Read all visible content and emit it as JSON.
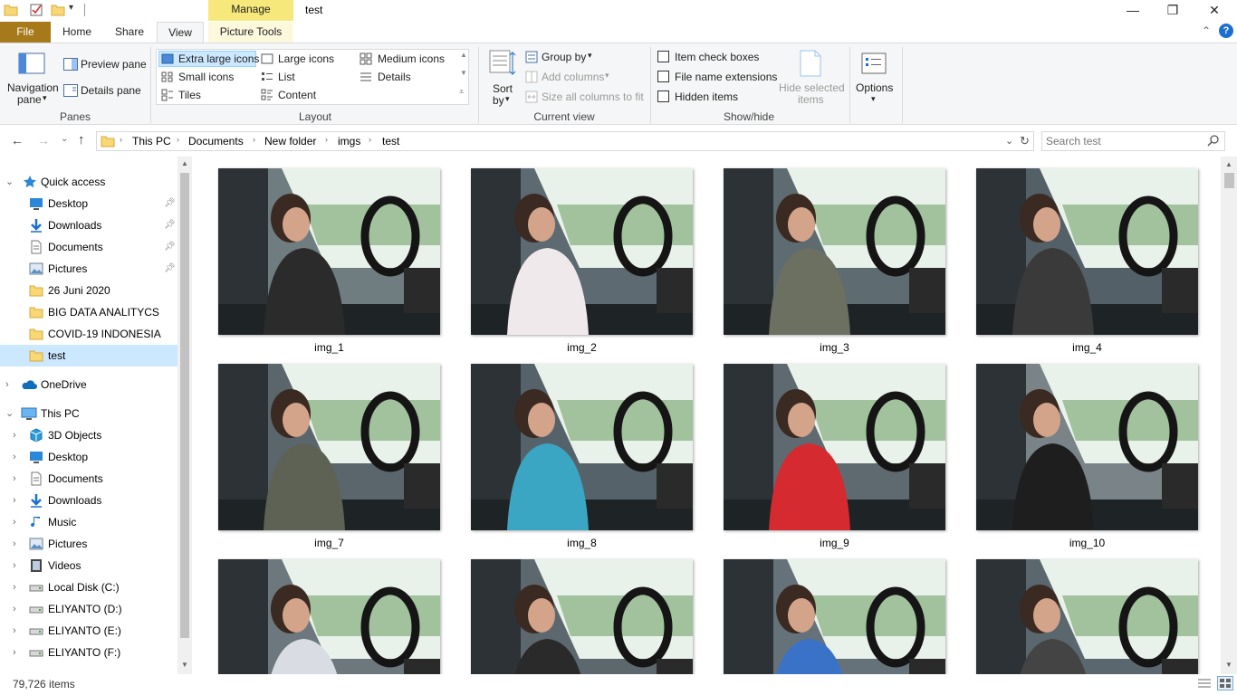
{
  "window": {
    "title": "test",
    "manage_tab": "Manage",
    "minimize": "—",
    "maximize": "❐",
    "close": "✕"
  },
  "tabs": [
    {
      "label": "File"
    },
    {
      "label": "Home"
    },
    {
      "label": "Share"
    },
    {
      "label": "View"
    },
    {
      "label": "Picture Tools"
    }
  ],
  "ribbon": {
    "panes": {
      "nav_pane_line1": "Navigation",
      "nav_pane_line2": "pane",
      "preview_pane": "Preview pane",
      "details_pane": "Details pane",
      "group_label": "Panes"
    },
    "layout": {
      "options": [
        "Extra large icons",
        "Large icons",
        "Medium icons",
        "Small icons",
        "List",
        "Details",
        "Tiles",
        "Content"
      ],
      "selected": "Extra large icons",
      "group_label": "Layout"
    },
    "current_view": {
      "sort_line1": "Sort",
      "sort_line2": "by",
      "group_by": "Group by",
      "add_columns": "Add columns",
      "size_all_columns": "Size all columns to fit",
      "group_label": "Current view"
    },
    "show_hide": {
      "item_check_boxes": "Item check boxes",
      "file_name_extensions": "File name extensions",
      "hidden_items": "Hidden items",
      "hide_selected_line1": "Hide selected",
      "hide_selected_line2": "items",
      "group_label": "Show/hide"
    },
    "options": {
      "label": "Options"
    }
  },
  "address": {
    "crumbs": [
      "This PC",
      "Documents",
      "New folder",
      "imgs",
      "test"
    ],
    "search_placeholder": "Search test"
  },
  "nav": {
    "quick_access": "Quick access",
    "quick_items": [
      {
        "label": "Desktop",
        "icon": "desktop-icon",
        "pinned": true
      },
      {
        "label": "Downloads",
        "icon": "downloads-icon",
        "pinned": true
      },
      {
        "label": "Documents",
        "icon": "documents-icon",
        "pinned": true
      },
      {
        "label": "Pictures",
        "icon": "pictures-icon",
        "pinned": true
      },
      {
        "label": "26 Juni 2020",
        "icon": "folder-icon",
        "pinned": false
      },
      {
        "label": "BIG DATA ANALITYCS",
        "icon": "folder-icon",
        "pinned": false
      },
      {
        "label": "COVID-19 INDONESIA",
        "icon": "folder-icon",
        "pinned": false
      },
      {
        "label": "test",
        "icon": "folder-icon",
        "pinned": false,
        "selected": true
      }
    ],
    "onedrive": "OneDrive",
    "this_pc": "This PC",
    "pc_items": [
      {
        "label": "3D Objects",
        "icon": "3d-objects-icon"
      },
      {
        "label": "Desktop",
        "icon": "desktop-icon"
      },
      {
        "label": "Documents",
        "icon": "documents-icon"
      },
      {
        "label": "Downloads",
        "icon": "downloads-icon"
      },
      {
        "label": "Music",
        "icon": "music-icon"
      },
      {
        "label": "Pictures",
        "icon": "pictures-icon"
      },
      {
        "label": "Videos",
        "icon": "videos-icon"
      },
      {
        "label": "Local Disk (C:)",
        "icon": "drive-icon"
      },
      {
        "label": "ELIYANTO (D:)",
        "icon": "drive-icon"
      },
      {
        "label": "ELIYANTO (E:)",
        "icon": "drive-icon"
      },
      {
        "label": "ELIYANTO (F:)",
        "icon": "drive-icon"
      }
    ]
  },
  "files": [
    {
      "name": "img_1",
      "shirt": "#2b2b2b",
      "tint": "#6f7d80"
    },
    {
      "name": "img_2",
      "shirt": "#efe9ec",
      "tint": "#5d6a72"
    },
    {
      "name": "img_3",
      "shirt": "#6c7060",
      "tint": "#5e6b70"
    },
    {
      "name": "img_4",
      "shirt": "#3a3a3a",
      "tint": "#546068"
    },
    {
      "name": "img_7",
      "shirt": "#5e6254",
      "tint": "#5b666c"
    },
    {
      "name": "img_8",
      "shirt": "#3aa6c4",
      "tint": "#56626a"
    },
    {
      "name": "img_9",
      "shirt": "#d42a30",
      "tint": "#5f6a70"
    },
    {
      "name": "img_10",
      "shirt": "#1e1e1e",
      "tint": "#7a8488"
    },
    {
      "name": "",
      "shirt": "#d9dde3",
      "tint": "#6c787e"
    },
    {
      "name": "",
      "shirt": "#2a2a2a",
      "tint": "#5d686e"
    },
    {
      "name": "",
      "shirt": "#3a72c8",
      "tint": "#65727a"
    },
    {
      "name": "",
      "shirt": "#444444",
      "tint": "#5b676e"
    }
  ],
  "status": {
    "count": "79,726 items"
  },
  "colors": {
    "file_tab": "#a6791a",
    "manage_tab": "#f6e87a",
    "selection": "#cce8ff",
    "accent": "#0078d7"
  }
}
